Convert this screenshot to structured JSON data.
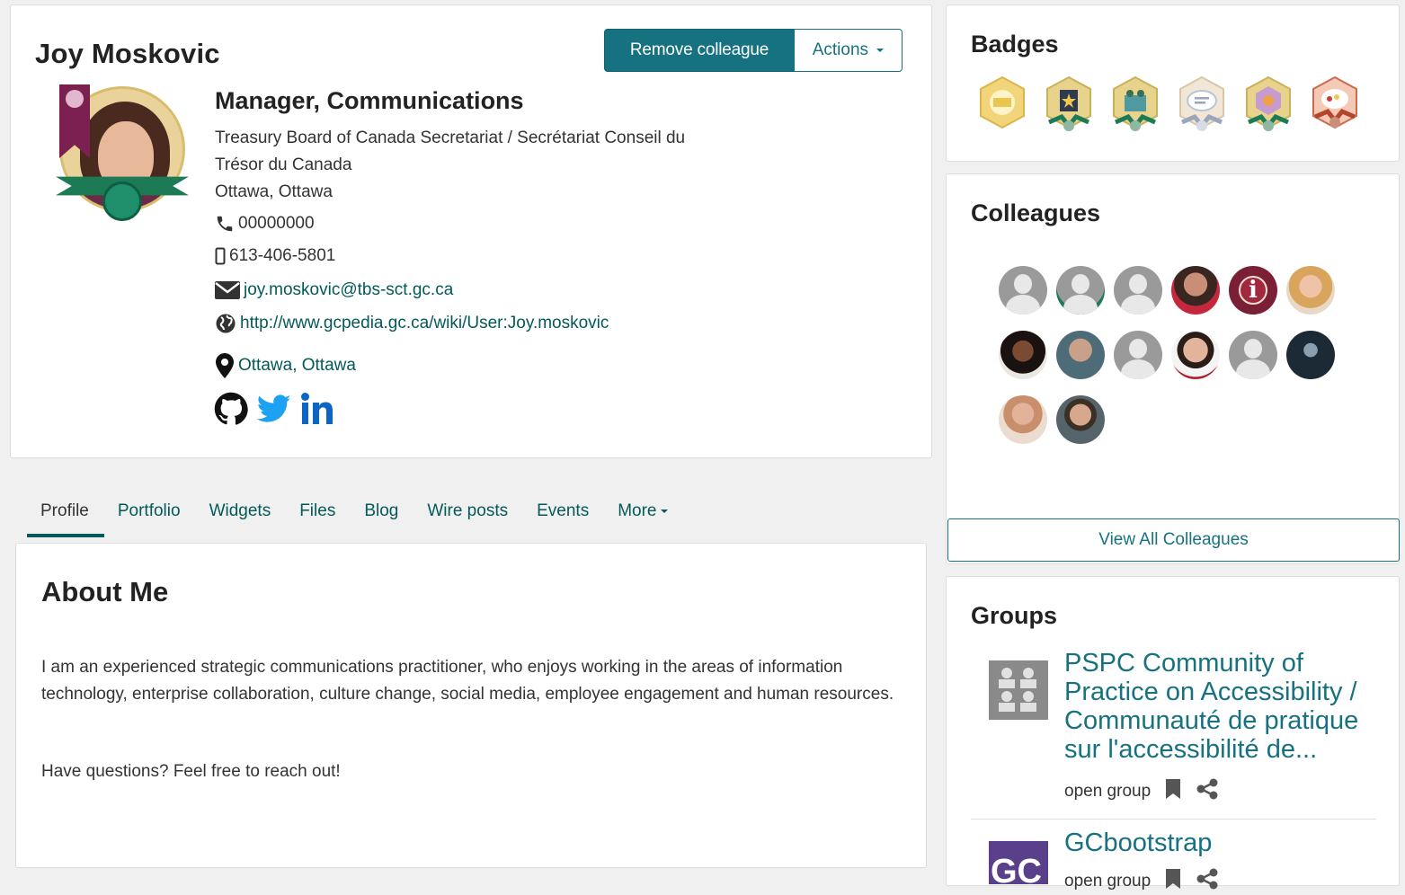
{
  "profile": {
    "name": "Joy Moskovic",
    "remove_label": "Remove colleague",
    "actions_label": "Actions",
    "job_title": "Manager, Communications",
    "department_line1": "Treasury Board of Canada Secretariat / Secrétariat Conseil du",
    "department_line2": "Trésor du Canada",
    "location": "Ottawa, Ottawa",
    "phone": "00000000",
    "mobile": "613-406-5801",
    "email": "joy.moskovic@tbs-sct.gc.ca",
    "website": "http://www.gcpedia.gc.ca/wiki/User:Joy.moskovic",
    "place": "Ottawa, Ottawa",
    "social": [
      "github-icon",
      "twitter-icon",
      "linkedin-icon"
    ]
  },
  "tabs": [
    {
      "label": "Profile",
      "active": true
    },
    {
      "label": "Portfolio"
    },
    {
      "label": "Widgets"
    },
    {
      "label": "Files"
    },
    {
      "label": "Blog"
    },
    {
      "label": "Wire posts"
    },
    {
      "label": "Events"
    },
    {
      "label": "More"
    }
  ],
  "about": {
    "title": "About Me",
    "paragraph1": "I am an experienced strategic communications practitioner, who enjoys working in the areas of information technology, enterprise collaboration, culture change, social media, employee engagement and human resources.",
    "paragraph2": "Have questions? Feel free to reach out!"
  },
  "badges": {
    "title": "Badges",
    "items": [
      "badge-1",
      "badge-2",
      "badge-3",
      "badge-4",
      "badge-5",
      "badge-6"
    ]
  },
  "colleagues": {
    "title": "Colleagues",
    "view_all_label": "View All Colleagues",
    "count": 14
  },
  "groups": {
    "title": "Groups",
    "items": [
      {
        "name": "PSPC Community of Practice on Accessibility / Communauté de pratique sur l'accessibilité de...",
        "type": "open group"
      },
      {
        "name": "GCbootstrap",
        "type": "open group"
      }
    ]
  },
  "colors": {
    "accent": "#167280",
    "link": "#055959"
  }
}
